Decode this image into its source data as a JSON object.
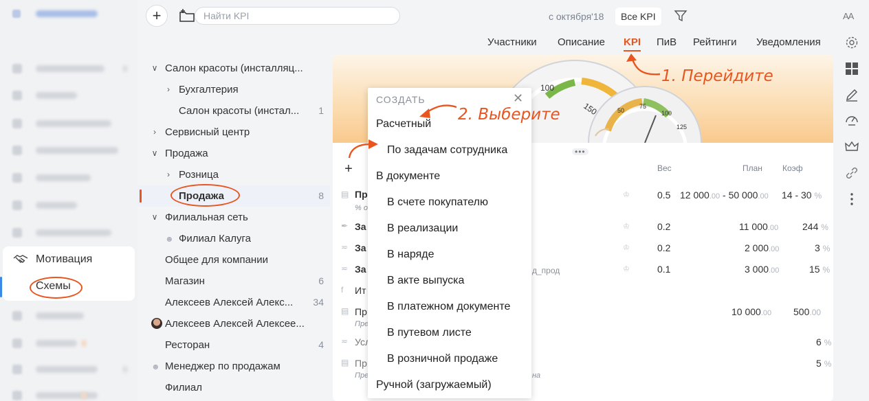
{
  "sidebar": {
    "active_section": "Мотивация",
    "active_item": "Схемы"
  },
  "toolbar": {
    "add_label": "+",
    "search_placeholder": "Найти KPI",
    "period": "с октября'18",
    "kpi_filter": "Все KPI",
    "font_size_label": "AA"
  },
  "tabs": [
    "Участники",
    "Описание",
    "KPI",
    "ПиВ",
    "Рейтинги",
    "Уведомления"
  ],
  "active_tab": "KPI",
  "tree": [
    {
      "label": "Салон красоты (инсталляц...",
      "chevron": "v",
      "count": ""
    },
    {
      "label": "Бухгалтерия",
      "chevron": ">",
      "count": ""
    },
    {
      "label": "Салон красоты (инстал...",
      "chevron": "",
      "count": "1"
    },
    {
      "label": "Сервисный центр",
      "chevron": ">",
      "count": ""
    },
    {
      "label": "Продажа",
      "chevron": "v",
      "count": ""
    },
    {
      "label": "Розница",
      "chevron": ">",
      "count": ""
    },
    {
      "label": "Продажа",
      "chevron": "",
      "count": "8"
    },
    {
      "label": "Филиальная сеть",
      "chevron": "v",
      "count": ""
    },
    {
      "label": "Филиал Калуга",
      "chevron": "",
      "count": ""
    },
    {
      "label": "Общее для компании",
      "chevron": "",
      "count": ""
    },
    {
      "label": "Магазин",
      "chevron": "",
      "count": "6"
    },
    {
      "label": "Алексеев Алексей Алекс...",
      "chevron": "",
      "count": "34"
    },
    {
      "label": "Алексеев Алексей Алексее...",
      "chevron": "",
      "count": ""
    },
    {
      "label": "Ресторан",
      "chevron": "",
      "count": "4"
    },
    {
      "label": "Менеджер по продажам",
      "chevron": "",
      "count": ""
    },
    {
      "label": "Филиал",
      "chevron": "",
      "count": ""
    }
  ],
  "gauges": {
    "big": [
      "100",
      "150"
    ],
    "small": [
      "50",
      "75",
      "100",
      "125"
    ]
  },
  "table": {
    "headers": {
      "weight": "Вес",
      "plan": "План",
      "coef": "Коэф"
    },
    "rows": [
      {
        "name": "Пр",
        "sub": "% о",
        "weight": "0.5",
        "plan": "12 000",
        "plan_dec": ".00",
        "plan_sep": " - ",
        "plan2": "50 000",
        "plan2_dec": ".00",
        "coef": "14 - 30",
        "pct": "%"
      },
      {
        "name": "За",
        "sub": "",
        "weight": "0.2",
        "plan": "11 000",
        "plan_dec": ".00",
        "coef": "244",
        "pct": "%"
      },
      {
        "name": "За",
        "sub": "",
        "weight": "0.2",
        "plan": "2 000",
        "plan_dec": ".00",
        "coef": "3",
        "pct": "%"
      },
      {
        "name": "За",
        "sub": "д_прод",
        "weight": "0.1",
        "plan": "3 000",
        "plan_dec": ".00",
        "coef": "15",
        "pct": "%"
      },
      {
        "name": "Ит",
        "sub": "",
        "weight": "",
        "plan": "",
        "plan_dec": "",
        "coef": "",
        "pct": ""
      },
      {
        "name": "Пр",
        "sub": "Пре",
        "weight": "",
        "plan": "10 000",
        "plan_dec": ".00",
        "coef": "500",
        "pct": ".00"
      },
      {
        "name": "Усл",
        "sub": "",
        "weight": "",
        "plan": "",
        "plan_dec": "",
        "coef": "6",
        "pct": "%"
      },
      {
        "name": "Пр",
        "sub": "Пре",
        "sub2": "на",
        "weight": "",
        "plan": "",
        "plan_dec": "",
        "coef": "5",
        "pct": "%"
      }
    ]
  },
  "menu": {
    "header": "СОЗДАТЬ",
    "items": [
      {
        "label": "Расчетный"
      },
      {
        "label": "По задачам сотрудника"
      },
      {
        "label": "В документе"
      },
      {
        "label": "В счете покупателю"
      },
      {
        "label": "В реализации"
      },
      {
        "label": "В наряде"
      },
      {
        "label": "В акте выпуска"
      },
      {
        "label": "В платежном документе"
      },
      {
        "label": "В путевом листе"
      },
      {
        "label": "В розничной продаже"
      },
      {
        "label": "Ручной (загружаемый)"
      }
    ]
  },
  "annotations": {
    "step1": "1. Перейдите",
    "step2": "2. Выберите"
  },
  "colors": {
    "accent": "#e8551f",
    "selection_bar": "#3a88e8"
  }
}
